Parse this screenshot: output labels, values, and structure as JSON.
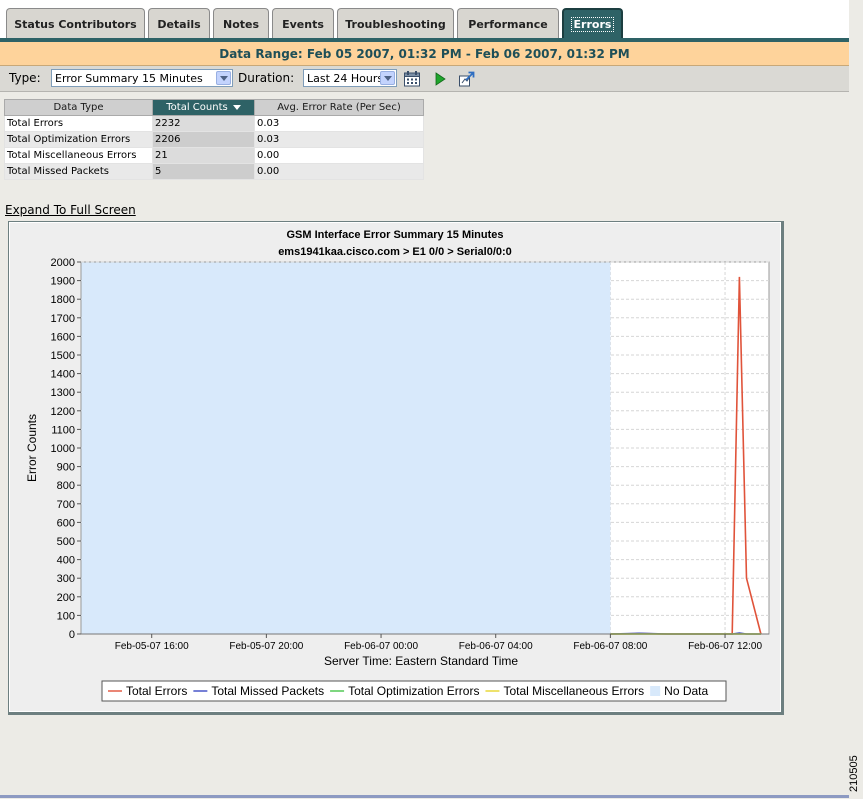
{
  "tabs": [
    {
      "label": "Status Contributors",
      "active": false
    },
    {
      "label": "Details",
      "active": false
    },
    {
      "label": "Notes",
      "active": false
    },
    {
      "label": "Events",
      "active": false
    },
    {
      "label": "Troubleshooting",
      "active": false
    },
    {
      "label": "Performance",
      "active": false
    },
    {
      "label": "Errors",
      "active": true
    }
  ],
  "range_text": "Data Range: Feb 05 2007, 01:32 PM - Feb 06 2007, 01:32 PM",
  "controls": {
    "type_label": "Type:",
    "type_value": "Error Summary 15 Minutes",
    "duration_label": "Duration:",
    "duration_value": "Last 24 Hours",
    "icons": [
      "calendar-icon",
      "play-icon",
      "export-icon"
    ]
  },
  "table": {
    "headers": [
      "Data Type",
      "Total Counts",
      "Avg. Error Rate (Per Sec)"
    ],
    "sorted_column": 1,
    "rows": [
      [
        "Total Errors",
        "2232",
        "0.03"
      ],
      [
        "Total Optimization Errors",
        "2206",
        "0.03"
      ],
      [
        "Total Miscellaneous Errors",
        "21",
        "0.00"
      ],
      [
        "Total Missed Packets",
        "5",
        "0.00"
      ]
    ]
  },
  "expand_link": "Expand To Full Screen",
  "chart_data": {
    "type": "line",
    "title": "GSM Interface Error Summary 15 Minutes",
    "subtitle": "ems1941kaa.cisco.com > E1 0/0 > Serial0/0:0",
    "xlabel": "Server Time: Eastern Standard Time",
    "ylabel": "Error Counts",
    "ylim": [
      0,
      2000
    ],
    "yticks": [
      0,
      100,
      200,
      300,
      400,
      500,
      600,
      700,
      800,
      900,
      1000,
      1100,
      1200,
      1300,
      1400,
      1500,
      1600,
      1700,
      1800,
      1900,
      2000
    ],
    "xlim": [
      "Feb-05-07 13:32",
      "Feb-06-07 13:32"
    ],
    "xticks": [
      {
        "t": "Feb-05-07 16:00",
        "label": "Feb-05-07 16:00"
      },
      {
        "t": "Feb-05-07 20:00",
        "label": "Feb-05-07 20:00"
      },
      {
        "t": "Feb-06-07 00:00",
        "label": "Feb-06-07 00:00"
      },
      {
        "t": "Feb-06-07 04:00",
        "label": "Feb-06-07 04:00"
      },
      {
        "t": "Feb-06-07 08:00",
        "label": "Feb-06-07 08:00"
      },
      {
        "t": "Feb-06-07 12:00",
        "label": "Feb-06-07 12:00"
      }
    ],
    "no_data_range": [
      "Feb-05-07 13:32",
      "Feb-06-07 08:00"
    ],
    "grid": true,
    "legend_position": "bottom",
    "series": [
      {
        "name": "Total Errors",
        "color": "#e0533a",
        "points": [
          [
            "Feb-06-07 08:00",
            0
          ],
          [
            "Feb-06-07 09:00",
            2
          ],
          [
            "Feb-06-07 10:00",
            0
          ],
          [
            "Feb-06-07 12:15",
            0
          ],
          [
            "Feb-06-07 12:30",
            1920
          ],
          [
            "Feb-06-07 12:45",
            300
          ],
          [
            "Feb-06-07 13:15",
            0
          ]
        ]
      },
      {
        "name": "Total Missed Packets",
        "color": "#3b49c4",
        "points": [
          [
            "Feb-06-07 08:00",
            0
          ],
          [
            "Feb-06-07 09:00",
            4
          ],
          [
            "Feb-06-07 10:00",
            0
          ],
          [
            "Feb-06-07 12:15",
            0
          ],
          [
            "Feb-06-07 12:30",
            5
          ],
          [
            "Feb-06-07 12:45",
            0
          ],
          [
            "Feb-06-07 13:15",
            0
          ]
        ]
      },
      {
        "name": "Total Optimization Errors",
        "color": "#46c44a",
        "points": [
          [
            "Feb-06-07 08:00",
            0
          ],
          [
            "Feb-06-07 13:15",
            0
          ]
        ]
      },
      {
        "name": "Total Miscellaneous Errors",
        "color": "#e6d62e",
        "points": [
          [
            "Feb-06-07 08:00",
            0
          ],
          [
            "Feb-06-07 13:15",
            0
          ]
        ]
      }
    ],
    "no_data_label": "No Data",
    "no_data_color": "#d8e9fb"
  },
  "watermark": "210505"
}
